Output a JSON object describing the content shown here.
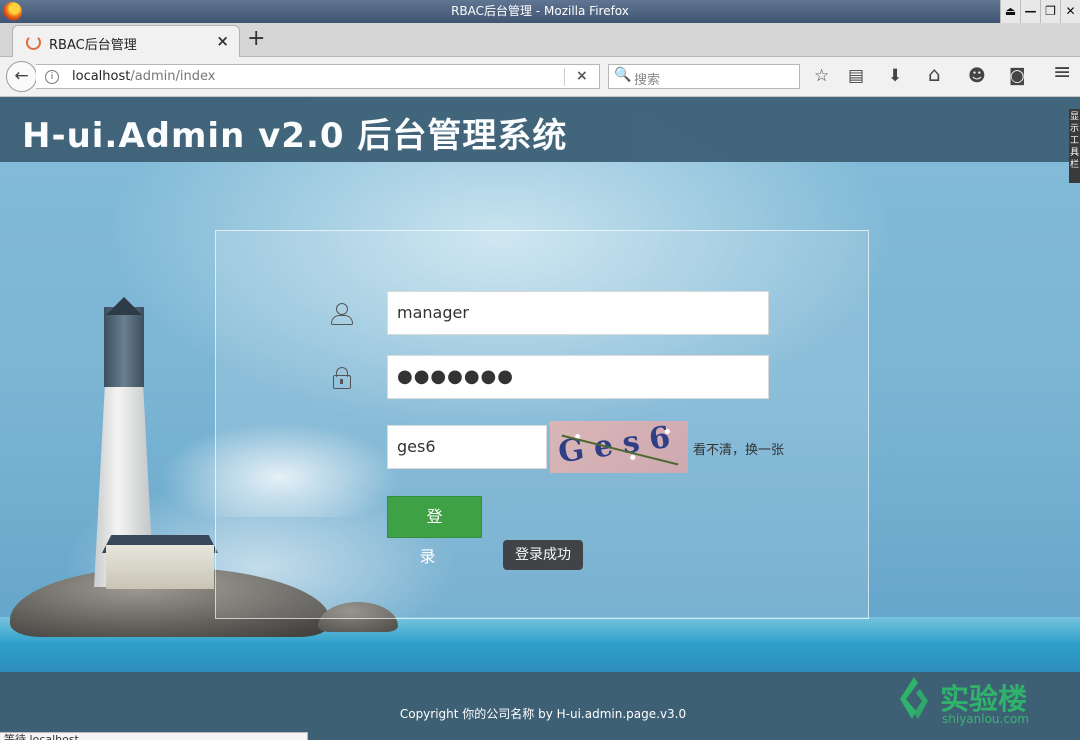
{
  "window": {
    "title": "RBAC后台管理 - Mozilla Firefox",
    "controls": [
      "⏏",
      "—",
      "❐",
      "✕"
    ]
  },
  "tab": {
    "title": "RBAC后台管理",
    "close": "×",
    "new_tab": "+"
  },
  "navbar": {
    "back": "←",
    "url_host": "localhost",
    "url_path": "/admin/index",
    "clear": "×",
    "search_icon": "🔍",
    "search_placeholder": "搜索",
    "toolbar_icons": [
      {
        "name": "bookmark-star-icon",
        "glyph": "☆"
      },
      {
        "name": "reader-view-icon",
        "glyph": "▤"
      },
      {
        "name": "download-icon",
        "glyph": "⬇"
      },
      {
        "name": "home-icon",
        "glyph": "⌂"
      },
      {
        "name": "chat-icon",
        "glyph": "☻"
      },
      {
        "name": "pocket-icon",
        "glyph": "◙"
      },
      {
        "name": "menu-icon",
        "glyph": "≡"
      }
    ]
  },
  "page": {
    "brand": "H-ui.Admin v2.0 后台管理系统",
    "side_toolbar_tab": "显示工具栏",
    "login": {
      "username_value": "manager",
      "password_value": "●●●●●●●",
      "captcha_value": "ges6",
      "captcha_image_text": "Ges6",
      "refresh_label": "看不清，换一张",
      "login_button": "登 录",
      "toast": "登录成功"
    },
    "footer": {
      "copyright": "Copyright 你的公司名称 by H-ui.admin.page.v3.0"
    },
    "watermark": {
      "title": "实验楼",
      "subtitle": "shiyanlou.com"
    }
  },
  "statusbar": {
    "text": "等待 localhost..."
  },
  "colors": {
    "header_bg": "#3f6278",
    "login_green": "#3fa145",
    "watermark_green": "#2fb36a"
  }
}
